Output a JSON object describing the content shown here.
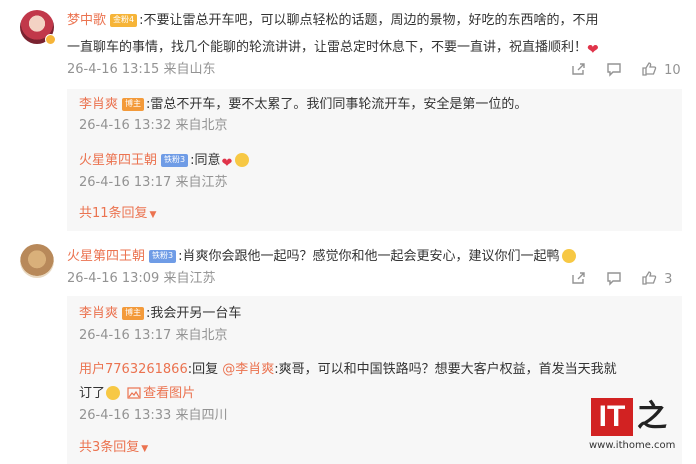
{
  "comment1": {
    "user": "梦中歌",
    "badge": "金粉4",
    "text": ":不要让雷总开车吧，可以聊点轻松的话题，周边的景物，好吃的东西啥的，不用",
    "text2": "一直聊车的事情，找几个能聊的轮流讲讲，让雷总定时休息下，不要一直讲，祝直播顺利！",
    "time": "26-4-16 13:15 来自山东",
    "likes": "10",
    "replies": [
      {
        "user": "李肖爽",
        "badge": "博主",
        "text": ":雷总不开车，要不太累了。我们同事轮流开车，安全是第一位的。",
        "time": "26-4-16 13:32 来自北京"
      },
      {
        "user": "火星第四王朝",
        "badge": "铁粉3",
        "text": ":同意",
        "time": "26-4-16 13:17 来自江苏"
      }
    ],
    "more": "共11条回复"
  },
  "comment2": {
    "user": "火星第四王朝",
    "badge": "铁粉3",
    "text": ":肖爽你会跟他一起吗？感觉你和他一起会更安心，建议你们一起鸭",
    "time": "26-4-16 13:09 来自江苏",
    "likes": "3",
    "replies": [
      {
        "user": "李肖爽",
        "badge": "博主",
        "text": ":我会开另一台车",
        "time": "26-4-16 13:17 来自北京"
      },
      {
        "user": "用户7763261866",
        "text": ":回复 ",
        "mention": "@李肖爽",
        "text_after": ":爽哥，可以和中国铁路吗？想要大客户权益，首发当天我就",
        "text2": "订了",
        "image_link": "查看图片",
        "time": "26-4-16 13:33 来自四川"
      }
    ],
    "more": "共3条回复"
  },
  "watermark": {
    "brand": "IT之家",
    "url": "www.ithome.com"
  },
  "colors": {
    "name": "#eb7350",
    "meta": "#939393",
    "reply_bg": "#f7f7f7"
  }
}
